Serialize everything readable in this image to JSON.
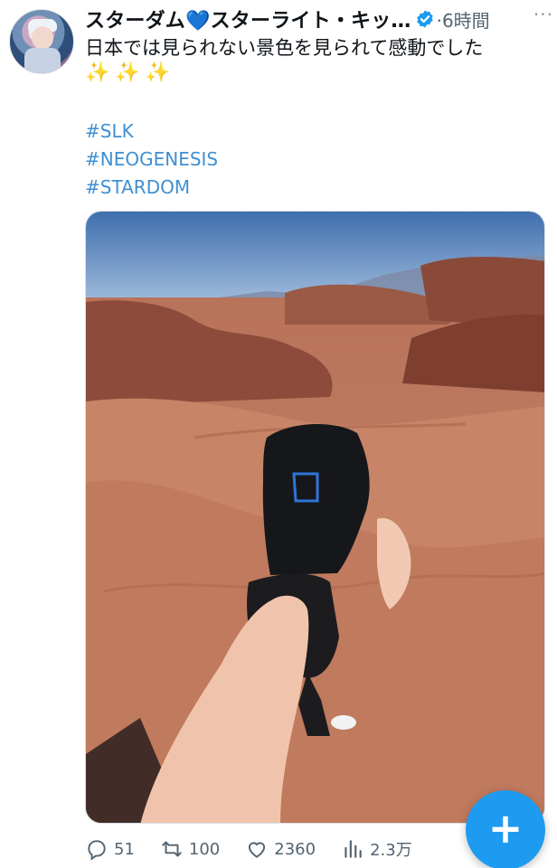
{
  "tweet": {
    "author_name": "スターダム💙スターライト・キッ…",
    "separator_time": "·6時間",
    "text": "日本では見られない景色を見られて感動でした",
    "sparkles": "✨✨✨",
    "hashtags": [
      "#SLK",
      "#NEOGENESIS",
      "#STARDOM"
    ],
    "more": "···"
  },
  "actions": {
    "replies": "51",
    "retweets": "100",
    "likes": "2360",
    "views": "2.3万"
  },
  "compose": {
    "label": "+"
  },
  "colors": {
    "accent": "#1d9bf0",
    "hashtag": "#3f8fd1",
    "secondary": "#536471"
  },
  "icons": [
    "verified-badge-icon",
    "reply-icon",
    "retweet-icon",
    "like-icon",
    "views-icon",
    "compose-plus-icon"
  ]
}
